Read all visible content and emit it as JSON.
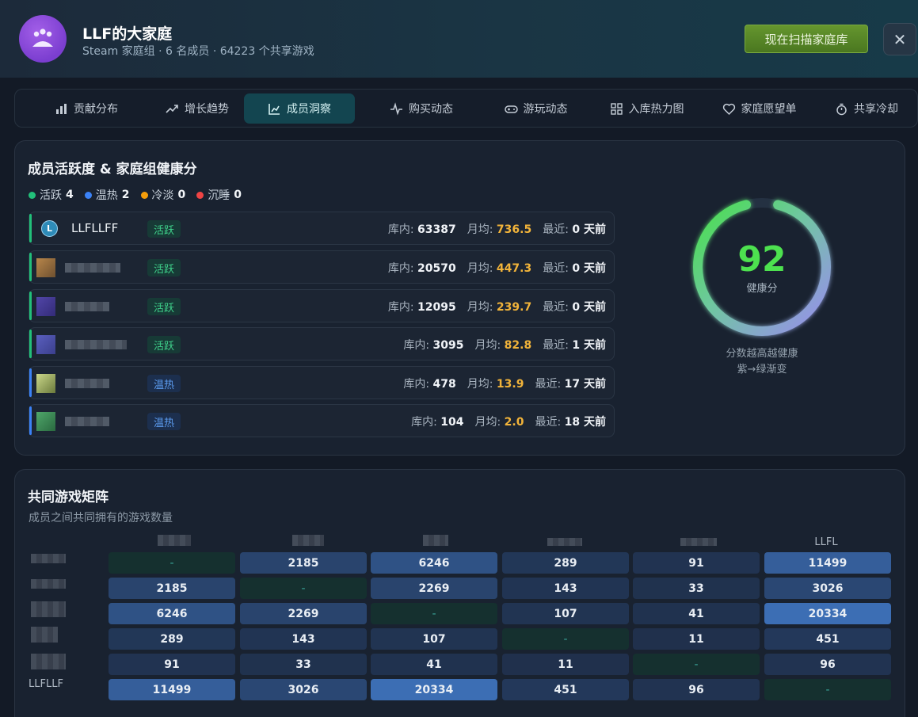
{
  "header": {
    "title": "LLF的大家庭",
    "subtitle": "Steam 家庭组 · 6 名成员 · 64223 个共享游戏",
    "scan_button": "现在扫描家庭库",
    "close_icon": "close-icon",
    "avatar_icon": "family-group-icon"
  },
  "tabs": [
    {
      "label": "贡献分布",
      "icon": "bar-chart-icon"
    },
    {
      "label": "增长趋势",
      "icon": "trend-up-icon"
    },
    {
      "label": "成员洞察",
      "icon": "line-chart-icon",
      "active": true
    },
    {
      "label": "购买动态",
      "icon": "pulse-icon"
    },
    {
      "label": "游玩动态",
      "icon": "gamepad-icon"
    },
    {
      "label": "入库热力图",
      "icon": "grid-icon"
    },
    {
      "label": "家庭愿望单",
      "icon": "heart-icon"
    },
    {
      "label": "共享冷却",
      "icon": "timer-icon"
    }
  ],
  "activity": {
    "title": "成员活跃度 & 家庭组健康分",
    "legend": [
      {
        "label": "活跃",
        "count": "4",
        "color": "#22c07a"
      },
      {
        "label": "温热",
        "count": "2",
        "color": "#3b82f6"
      },
      {
        "label": "冷淡",
        "count": "0",
        "color": "#f59e0b"
      },
      {
        "label": "沉睡",
        "count": "0",
        "color": "#ef4444"
      }
    ],
    "labels": {
      "library": "库内:",
      "monthly": "月均:",
      "recent": "最近:"
    },
    "members": [
      {
        "name": "LLFLLFF",
        "avatar_letter": "L",
        "status": "活跃",
        "library": "63387",
        "monthly": "736.5",
        "recent": "0 天前"
      },
      {
        "name": "",
        "status": "活跃",
        "library": "20570",
        "monthly": "447.3",
        "recent": "0 天前"
      },
      {
        "name": "",
        "status": "活跃",
        "library": "12095",
        "monthly": "239.7",
        "recent": "0 天前"
      },
      {
        "name": "",
        "status": "活跃",
        "library": "3095",
        "monthly": "82.8",
        "recent": "1 天前"
      },
      {
        "name": "",
        "status": "温热",
        "library": "478",
        "monthly": "13.9",
        "recent": "17 天前"
      },
      {
        "name": "",
        "status": "温热",
        "library": "104",
        "monthly": "2.0",
        "recent": "18 天前"
      }
    ],
    "health": {
      "score": "92",
      "score_fraction": 0.92,
      "label": "健康分",
      "note_line1": "分数越高越健康",
      "note_line2": "紫→绿渐变"
    }
  },
  "matrix": {
    "title": "共同游戏矩阵",
    "subtitle": "成员之间共同拥有的游戏数量",
    "last_col_header": "LLFL",
    "last_row_header": "LLFLLF",
    "diagonal": "-",
    "values": [
      [
        "-",
        "2185",
        "6246",
        "289",
        "91",
        "11499"
      ],
      [
        "2185",
        "-",
        "2269",
        "143",
        "33",
        "3026"
      ],
      [
        "6246",
        "2269",
        "-",
        "107",
        "41",
        "20334"
      ],
      [
        "289",
        "143",
        "107",
        "-",
        "11",
        "451"
      ],
      [
        "91",
        "33",
        "41",
        "11",
        "-",
        "96"
      ],
      [
        "11499",
        "3026",
        "20334",
        "451",
        "96",
        "-"
      ]
    ]
  }
}
